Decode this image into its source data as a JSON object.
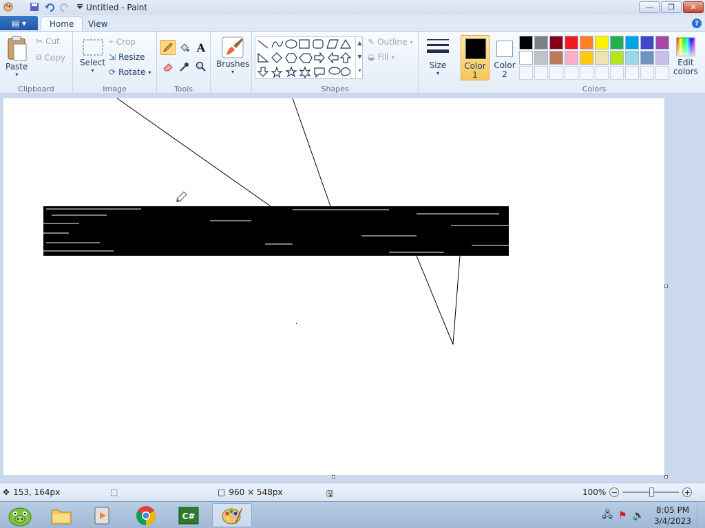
{
  "window": {
    "title": "Untitled - Paint"
  },
  "tabs": {
    "home": "Home",
    "view": "View"
  },
  "clipboard": {
    "paste": "Paste",
    "cut": "Cut",
    "copy": "Copy",
    "label": "Clipboard"
  },
  "image": {
    "select": "Select",
    "crop": "Crop",
    "resize": "Resize",
    "rotate": "Rotate",
    "label": "Image"
  },
  "tools": {
    "label": "Tools"
  },
  "brushes": {
    "label": "Brushes"
  },
  "shapes": {
    "label": "Shapes",
    "outline": "Outline",
    "fill": "Fill"
  },
  "size": {
    "label": "Size"
  },
  "color1": {
    "label_line1": "Color",
    "label_line2": "1",
    "value": "#000000"
  },
  "color2": {
    "label_line1": "Color",
    "label_line2": "2",
    "value": "#ffffff"
  },
  "colors": {
    "label": "Colors",
    "edit_line1": "Edit",
    "edit_line2": "colors",
    "palette": [
      "#000000",
      "#7f7f7f",
      "#880015",
      "#ed1c24",
      "#ff7f27",
      "#fff200",
      "#22b14c",
      "#00a2e8",
      "#3f48cc",
      "#a349a4",
      "#ffffff",
      "#c3c3c3",
      "#b97a57",
      "#ffaec9",
      "#ffc90e",
      "#efe4b0",
      "#b5e61d",
      "#99d9ea",
      "#7092be",
      "#c8bfe7"
    ]
  },
  "status": {
    "cursor_pos": "153, 164px",
    "canvas_size": "960 × 548px",
    "zoom": "100%"
  },
  "taskbar": {
    "time": "8:05 PM",
    "date": "3/4/2023"
  }
}
